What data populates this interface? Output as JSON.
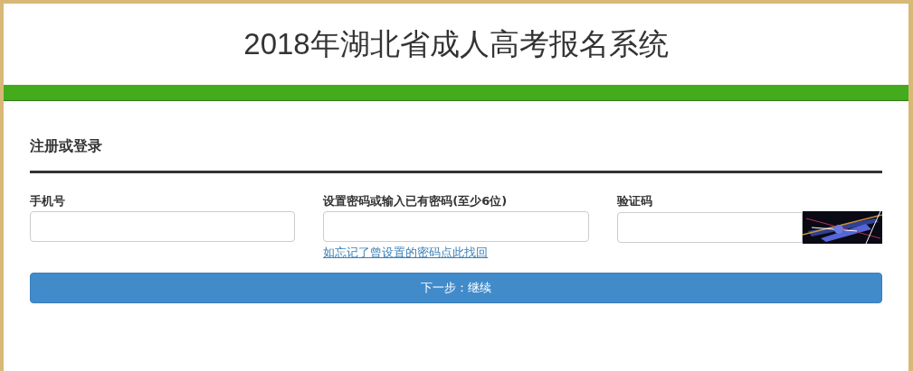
{
  "header": {
    "title": "2018年湖北省成人高考报名系统"
  },
  "form": {
    "heading": "注册或登录",
    "fields": [
      {
        "kind": "text",
        "label": "手机号"
      },
      {
        "kind": "password",
        "label": "设置密码或输入已有密码(至少6位)",
        "link": "如忘记了曾设置的密码点此找回"
      },
      {
        "kind": "captcha",
        "label": "验证码"
      }
    ],
    "submit": "下一步：继续"
  }
}
